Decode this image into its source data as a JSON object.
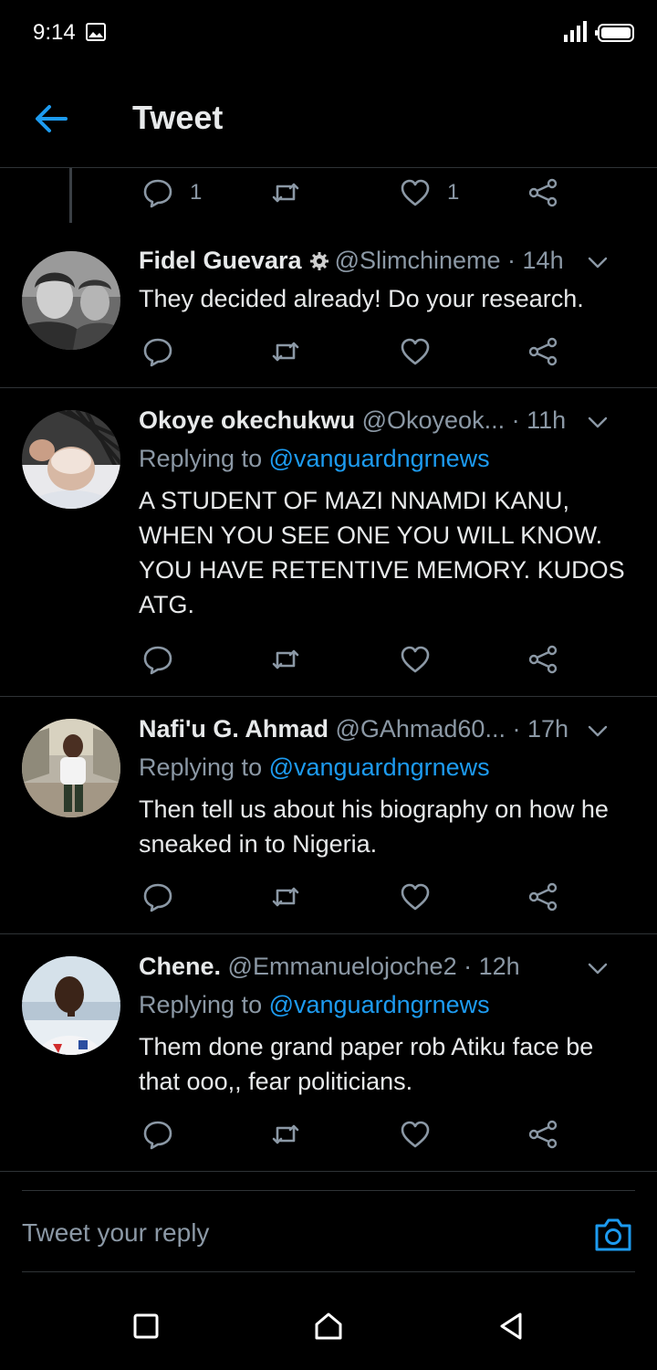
{
  "status_bar": {
    "time": "9:14"
  },
  "header": {
    "title": "Tweet"
  },
  "top_actions": {
    "reply_count": "1",
    "like_count": "1"
  },
  "tweets": [
    {
      "name": "Fidel Guevara",
      "handle": "@Slimchineme · 14h",
      "verified_icon": "gear-badge-icon",
      "text": "They decided already! Do your research."
    },
    {
      "name": "Okoye okechukwu",
      "handle": "@Okoyeok... · 11h",
      "replying_prefix": "Replying to ",
      "replying_to": "@vanguardngrnews",
      "text": "A STUDENT OF MAZI NNAMDI KANU, WHEN YOU SEE ONE YOU WILL KNOW. YOU HAVE RETENTIVE MEMORY. KUDOS ATG."
    },
    {
      "name": "Nafi'u G. Ahmad",
      "handle": "@GAhmad60... · 17h",
      "replying_prefix": "Replying to ",
      "replying_to": "@vanguardngrnews",
      "text": "Then tell us about his biography on how he sneaked in to Nigeria."
    },
    {
      "name": "Chene.",
      "handle": "@Emmanuelojoche2 · 12h",
      "replying_prefix": "Replying to ",
      "replying_to": "@vanguardngrnews",
      "text": "Them done grand paper rob Atiku face be that ooo,, fear politicians."
    }
  ],
  "reply_bar": {
    "placeholder": "Tweet your reply"
  },
  "colors": {
    "background": "#000000",
    "accent": "#1d9bf0",
    "muted": "#8b98a5",
    "divider": "#2f3336"
  }
}
